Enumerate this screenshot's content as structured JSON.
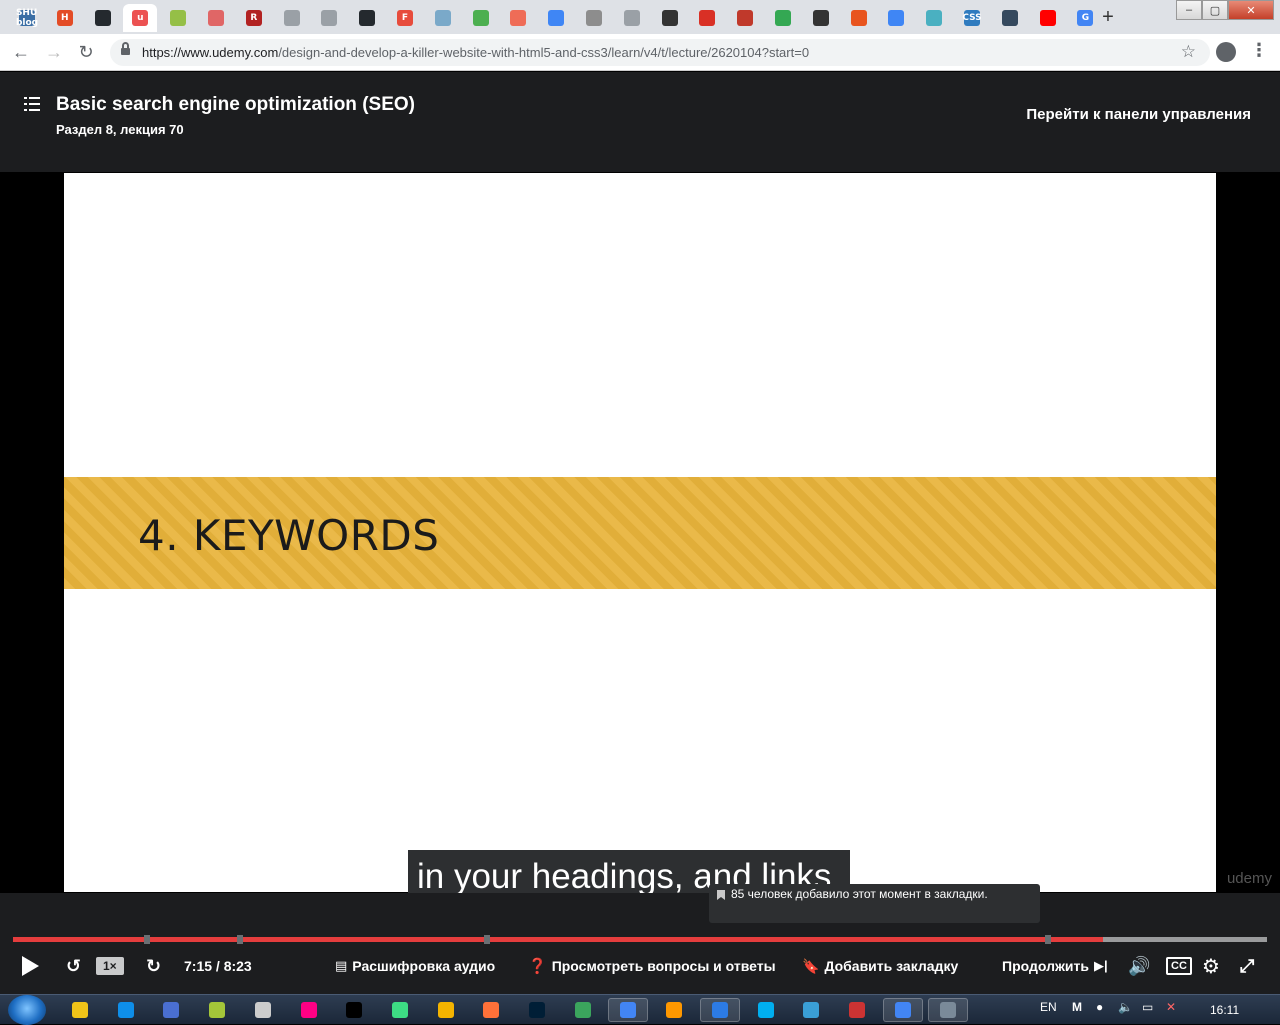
{
  "browser": {
    "tabs": [
      {
        "icon": "shu-blog-icon",
        "label": "SHU blog",
        "color": "#3a6ea5"
      },
      {
        "icon": "html-icon",
        "label": "H",
        "color": "#e34c26"
      },
      {
        "icon": "github-icon",
        "label": "",
        "color": "#24292e"
      },
      {
        "icon": "udemy-icon",
        "label": "u",
        "color": "#ec5252",
        "active": true
      },
      {
        "icon": "shopify-icon",
        "label": "",
        "color": "#95bf47"
      },
      {
        "icon": "diamond-icon",
        "label": "",
        "color": "#e06666"
      },
      {
        "icon": "r-icon",
        "label": "R",
        "color": "#b22222"
      },
      {
        "icon": "doc-icon",
        "label": "",
        "color": "#9aa0a6"
      },
      {
        "icon": "doc-icon",
        "label": "",
        "color": "#9aa0a6"
      },
      {
        "icon": "github-icon",
        "label": "",
        "color": "#24292e"
      },
      {
        "icon": "f-icon",
        "label": "F",
        "color": "#e74c3c"
      },
      {
        "icon": "window-icon",
        "label": "",
        "color": "#7aa9c9"
      },
      {
        "icon": "chart-icon",
        "label": "",
        "color": "#4caf50"
      },
      {
        "icon": "asterisk-icon",
        "label": "",
        "color": "#ef6c57"
      },
      {
        "icon": "grid-icon",
        "label": "",
        "color": "#3f86f5"
      },
      {
        "icon": "drive-icon",
        "label": "",
        "color": "#8d8d8d"
      },
      {
        "icon": "doc-icon",
        "label": "",
        "color": "#9aa0a6"
      },
      {
        "icon": "codepen-icon",
        "label": "",
        "color": "#333333"
      },
      {
        "icon": "map-pin-icon",
        "label": "",
        "color": "#d93025"
      },
      {
        "icon": "bar-icon",
        "label": "",
        "color": "#c0392b"
      },
      {
        "icon": "refresh-icon",
        "label": "",
        "color": "#34a853"
      },
      {
        "icon": "play-icon",
        "label": "",
        "color": "#333333"
      },
      {
        "icon": "shield-icon",
        "label": "",
        "color": "#e8541e"
      },
      {
        "icon": "image-icon",
        "label": "",
        "color": "#3f86f5"
      },
      {
        "icon": "cloud-icon",
        "label": "",
        "color": "#4ab0c1"
      },
      {
        "icon": "css-icon",
        "label": "CSS",
        "color": "#2f7bbf"
      },
      {
        "icon": "vue-icon",
        "label": "",
        "color": "#35495e"
      },
      {
        "icon": "youtube-icon",
        "label": "",
        "color": "#ff0000"
      },
      {
        "icon": "google-icon",
        "label": "G",
        "color": "#4285f4"
      }
    ],
    "address": {
      "host": "https://www.udemy.com",
      "path": "/design-and-develop-a-killer-website-with-html5-and-css3/learn/v4/t/lecture/2620104?start=0"
    }
  },
  "header": {
    "title": "Basic search engine optimization (SEO)",
    "subtitle": "Раздел 8, лекция 70",
    "dashboard_link": "Перейти к панели управления"
  },
  "video": {
    "slide_title": "4. KEYWORDS",
    "caption": "in your headings, and links.",
    "watermark": "udemy"
  },
  "player": {
    "progress_fraction": 0.869,
    "bookmark_positions": [
      0.107,
      0.181,
      0.378,
      0.825
    ],
    "tooltip": "85 человек добавило этот момент в закладки.",
    "rate": "1×",
    "time": "7:15 / 8:23",
    "transcript": "Расшифровка аудио",
    "qa": "Просмотреть вопросы и ответы",
    "bookmark": "Добавить закладку",
    "continue": "Продолжить"
  },
  "taskbar": {
    "apps": [
      {
        "icon": "explorer-icon",
        "color": "#f0c419"
      },
      {
        "icon": "teamviewer-icon",
        "color": "#0e8ee9"
      },
      {
        "icon": "floppy-icon",
        "color": "#4a6fd1"
      },
      {
        "icon": "android-icon",
        "color": "#a4c639"
      },
      {
        "icon": "box-icon",
        "color": "#cccccc"
      },
      {
        "icon": "flickr-icon",
        "color": "#ff0084"
      },
      {
        "icon": "intellij-icon",
        "color": "#000000"
      },
      {
        "icon": "leaf-icon",
        "color": "#3ddc84"
      },
      {
        "icon": "chrome-canary-icon",
        "color": "#f4b400"
      },
      {
        "icon": "firefox-icon",
        "color": "#ff7139"
      },
      {
        "icon": "photoshop-icon",
        "color": "#001e36"
      },
      {
        "icon": "recycle-icon",
        "color": "#3ba55d"
      },
      {
        "icon": "chrome-icon",
        "color": "#4285f4",
        "running": true
      },
      {
        "icon": "sublime-icon",
        "color": "#ff9800"
      },
      {
        "icon": "window-app-icon",
        "color": "#2c7be5",
        "running": true
      },
      {
        "icon": "skype-icon",
        "color": "#00aff0"
      },
      {
        "icon": "calculator-icon",
        "color": "#3a9fd6"
      },
      {
        "icon": "flag-icon",
        "color": "#cc3333"
      },
      {
        "icon": "chrome-icon",
        "color": "#4285f4",
        "running": true
      },
      {
        "icon": "settings-app-icon",
        "color": "#7a8a99",
        "running": true
      }
    ],
    "lang": "EN",
    "clock": "16:11"
  },
  "colors": {
    "accent_red": "#e53d3d",
    "band": "#e8b43b",
    "header_bg": "#1c1d1f"
  }
}
